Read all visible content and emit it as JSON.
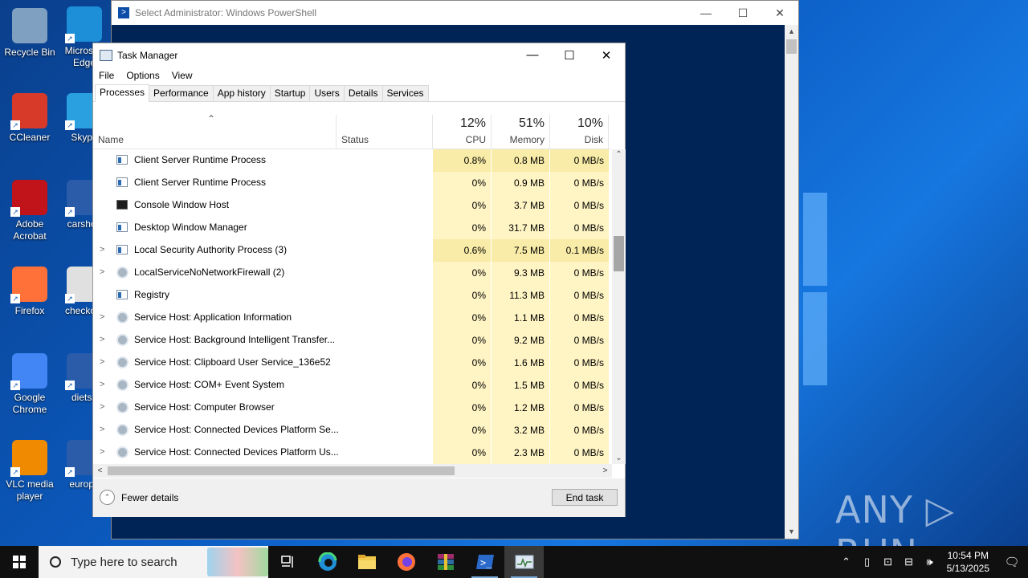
{
  "desktop": {
    "icons": [
      {
        "label": "Recycle Bin"
      },
      {
        "label": "Microsoft Edge"
      },
      {
        "label": "CCleaner"
      },
      {
        "label": "Skype"
      },
      {
        "label": "Adobe Acrobat"
      },
      {
        "label": "carshop"
      },
      {
        "label": "Firefox"
      },
      {
        "label": "checkout"
      },
      {
        "label": "Google Chrome"
      },
      {
        "label": "dietsu"
      },
      {
        "label": "VLC media player"
      },
      {
        "label": "europe"
      }
    ],
    "watermark": "ANY ▷ RUN"
  },
  "powershell": {
    "title": "Select Administrator: Windows PowerShell",
    "minimize": "—",
    "maximize": "☐",
    "close": "✕"
  },
  "taskmanager": {
    "title": "Task Manager",
    "minimize": "—",
    "maximize": "☐",
    "close": "✕",
    "menu": [
      "File",
      "Options",
      "View"
    ],
    "tabs": [
      "Processes",
      "Performance",
      "App history",
      "Startup",
      "Users",
      "Details",
      "Services"
    ],
    "columns": {
      "name": "Name",
      "status": "Status",
      "cpu_pct": "12%",
      "cpu": "CPU",
      "mem_pct": "51%",
      "mem": "Memory",
      "disk_pct": "10%",
      "disk": "Disk"
    },
    "rows": [
      {
        "expand": "",
        "icon": "window",
        "name": "Client Server Runtime Process",
        "cpu": "0.8%",
        "mem": "0.8 MB",
        "disk": "0 MB/s",
        "hot": true
      },
      {
        "expand": "",
        "icon": "window",
        "name": "Client Server Runtime Process",
        "cpu": "0%",
        "mem": "0.9 MB",
        "disk": "0 MB/s",
        "hot": false
      },
      {
        "expand": "",
        "icon": "console",
        "name": "Console Window Host",
        "cpu": "0%",
        "mem": "3.7 MB",
        "disk": "0 MB/s",
        "hot": false
      },
      {
        "expand": "",
        "icon": "window",
        "name": "Desktop Window Manager",
        "cpu": "0%",
        "mem": "31.7 MB",
        "disk": "0 MB/s",
        "hot": false
      },
      {
        "expand": ">",
        "icon": "window",
        "name": "Local Security Authority Process (3)",
        "cpu": "0.6%",
        "mem": "7.5 MB",
        "disk": "0.1 MB/s",
        "hot": true
      },
      {
        "expand": ">",
        "icon": "gear",
        "name": "LocalServiceNoNetworkFirewall (2)",
        "cpu": "0%",
        "mem": "9.3 MB",
        "disk": "0 MB/s",
        "hot": false
      },
      {
        "expand": "",
        "icon": "window",
        "name": "Registry",
        "cpu": "0%",
        "mem": "11.3 MB",
        "disk": "0 MB/s",
        "hot": false
      },
      {
        "expand": ">",
        "icon": "gear",
        "name": "Service Host: Application Information",
        "cpu": "0%",
        "mem": "1.1 MB",
        "disk": "0 MB/s",
        "hot": false
      },
      {
        "expand": ">",
        "icon": "gear",
        "name": "Service Host: Background Intelligent Transfer...",
        "cpu": "0%",
        "mem": "9.2 MB",
        "disk": "0 MB/s",
        "hot": false
      },
      {
        "expand": ">",
        "icon": "gear",
        "name": "Service Host: Clipboard User Service_136e52",
        "cpu": "0%",
        "mem": "1.6 MB",
        "disk": "0 MB/s",
        "hot": false
      },
      {
        "expand": ">",
        "icon": "gear",
        "name": "Service Host: COM+ Event System",
        "cpu": "0%",
        "mem": "1.5 MB",
        "disk": "0 MB/s",
        "hot": false
      },
      {
        "expand": ">",
        "icon": "gear",
        "name": "Service Host: Computer Browser",
        "cpu": "0%",
        "mem": "1.2 MB",
        "disk": "0 MB/s",
        "hot": false
      },
      {
        "expand": ">",
        "icon": "gear",
        "name": "Service Host: Connected Devices Platform Se...",
        "cpu": "0%",
        "mem": "3.2 MB",
        "disk": "0 MB/s",
        "hot": false
      },
      {
        "expand": ">",
        "icon": "gear",
        "name": "Service Host: Connected Devices Platform Us...",
        "cpu": "0%",
        "mem": "2.3 MB",
        "disk": "0 MB/s",
        "hot": false
      }
    ],
    "fewer_details": "Fewer details",
    "end_task": "End task"
  },
  "taskbar": {
    "search_placeholder": "Type here to search",
    "time": "10:54 PM",
    "date": "5/13/2025"
  }
}
